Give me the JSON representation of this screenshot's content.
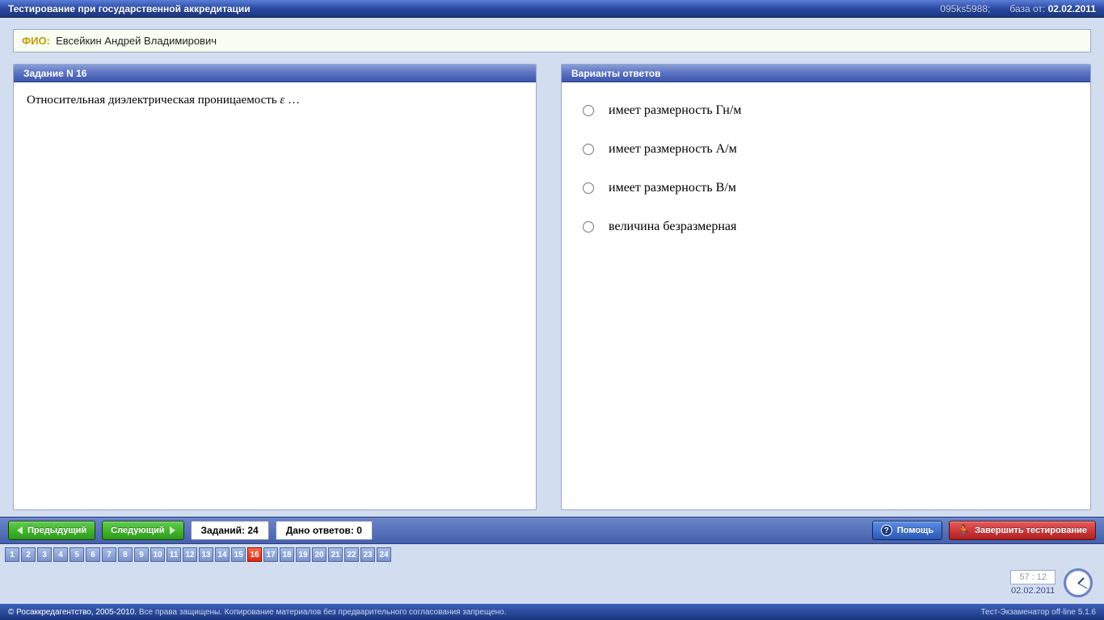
{
  "titlebar": {
    "title": "Тестирование при государственной аккредитации",
    "code": "095ks5988;",
    "db_label": "база от:",
    "db_date": "02.02.2011"
  },
  "fio": {
    "label": "ФИО:",
    "name": "Евсейкин Андрей Владимирович"
  },
  "question": {
    "header": "Задание N 16",
    "text_prefix": "Относительная диэлектрическая проницаемость ",
    "symbol": "ε",
    "text_suffix": "  …"
  },
  "answers": {
    "header": "Варианты ответов",
    "items": [
      "имеет размерность Гн/м",
      "имеет размерность А/м",
      "имеет размерность В/м",
      "величина безразмерная"
    ]
  },
  "controls": {
    "prev": "Предыдущий",
    "next": "Следующий",
    "total_label": "Заданий:",
    "total_value": "24",
    "answered_label": "Дано ответов:",
    "answered_value": "0",
    "help": "Помощь",
    "finish": "Завершить тестирование"
  },
  "qnav": {
    "count": 24,
    "active": 16
  },
  "clock": {
    "time": "57 : 12",
    "date": "02.02.2011"
  },
  "footer": {
    "copyright": "© Росаккредагентство, 2005-2010.",
    "rights": "Все права защищены. Копирование материалов без предварительного согласования запрещено.",
    "product": "Тест-Экзаменатор off-line 5.1.6"
  }
}
